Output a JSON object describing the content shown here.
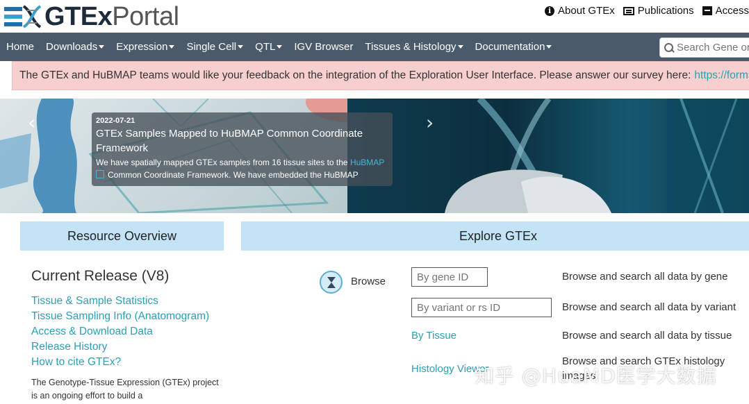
{
  "header": {
    "logo_bold": "GTEx",
    "logo_light": "Portal",
    "links": [
      {
        "label": "About GTEx",
        "icon": "info-icon"
      },
      {
        "label": "Publications",
        "icon": "newspaper-icon"
      },
      {
        "label": "Access",
        "icon": "archive-icon"
      }
    ]
  },
  "nav": {
    "items": [
      {
        "label": "Home",
        "dropdown": false
      },
      {
        "label": "Downloads",
        "dropdown": true
      },
      {
        "label": "Expression",
        "dropdown": true
      },
      {
        "label": "Single Cell",
        "dropdown": true
      },
      {
        "label": "QTL",
        "dropdown": true
      },
      {
        "label": "IGV Browser",
        "dropdown": false
      },
      {
        "label": "Tissues & Histology",
        "dropdown": true
      },
      {
        "label": "Documentation",
        "dropdown": true
      }
    ],
    "search_placeholder": "Search Gene or"
  },
  "alert": {
    "text": "The GTEx and HuBMAP teams would like your feedback on the integration of the Exploration User Interface. Please answer our survey here:",
    "link": "https://forms"
  },
  "carousel": {
    "date": "2022-07-21",
    "title": "GTEx Samples Mapped to HuBMAP Common Coordinate Framework",
    "body_before": "We have spatially mapped GTEx samples from 16 tissue sites to the",
    "body_link": "HuBMAP",
    "body_after": "Common Coordinate Framework. We have embedded the HuBMAP"
  },
  "resource": {
    "heading": "Resource Overview",
    "release": "Current Release (V8)",
    "links": [
      "Tissue & Sample Statistics",
      "Tissue Sampling Info (Anatomogram)",
      "Access & Download Data",
      "Release History",
      "How to cite GTEx?"
    ],
    "paragraph": "The Genotype-Tissue Expression (GTEx) project is an ongoing effort to build a"
  },
  "explore": {
    "heading": "Explore GTEx",
    "browse_label": "Browse",
    "gene_placeholder": "By gene ID",
    "variant_placeholder": "By variant or rs ID",
    "by_tissue": "By Tissue",
    "histology_viewer": "Histology Viewer",
    "descriptions": {
      "gene": "Browse and search all data by gene",
      "variant": "Browse and search all data by variant",
      "tissue": "Browse and search all data by tissue",
      "histology_line1": "Browse and search GTEx histology",
      "histology_line2": "images"
    }
  },
  "watermark": "知乎 @HuaMD医学大数据",
  "colors": {
    "nav_bg": "#4a5a6a",
    "alert_bg": "#f7cfcf",
    "panel_head_bg": "#c3e3f7",
    "link": "#2a9fb6"
  }
}
